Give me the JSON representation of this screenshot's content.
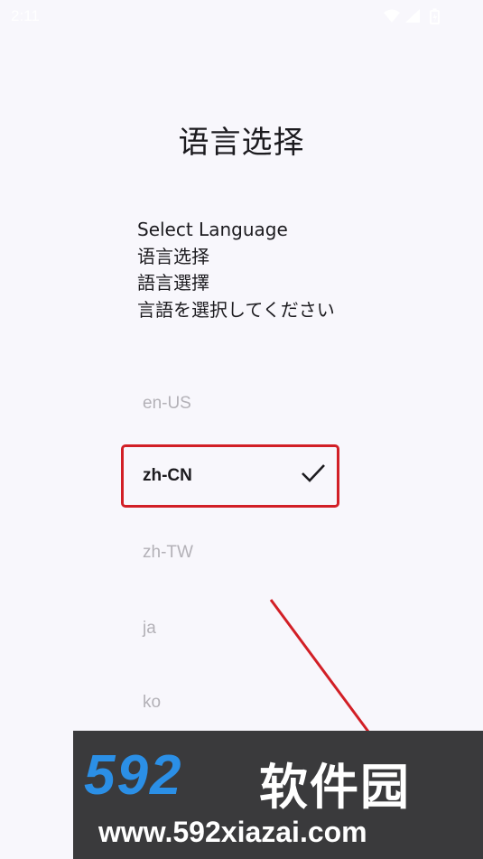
{
  "status_bar": {
    "time": "2:11",
    "icons": [
      "wifi-icon",
      "signal-icon",
      "battery-icon"
    ]
  },
  "page": {
    "title": "语言选择",
    "prompts": [
      "Select Language",
      "语言选择",
      "語言選擇",
      "言語を選択してください"
    ]
  },
  "languages": {
    "items": [
      {
        "code": "en-US",
        "selected": false
      },
      {
        "code": "zh-CN",
        "selected": true
      },
      {
        "code": "zh-TW",
        "selected": false
      },
      {
        "code": "ja",
        "selected": false
      },
      {
        "code": "ko",
        "selected": false
      }
    ]
  },
  "colors": {
    "highlight": "#d21f26",
    "background": "#f8f7fc",
    "selected_text": "#1c1b1f",
    "unselected_text": "#b3b1b7"
  },
  "watermark": {
    "logo": "592",
    "name": "软件园",
    "url": "www.592xiazai.com"
  }
}
